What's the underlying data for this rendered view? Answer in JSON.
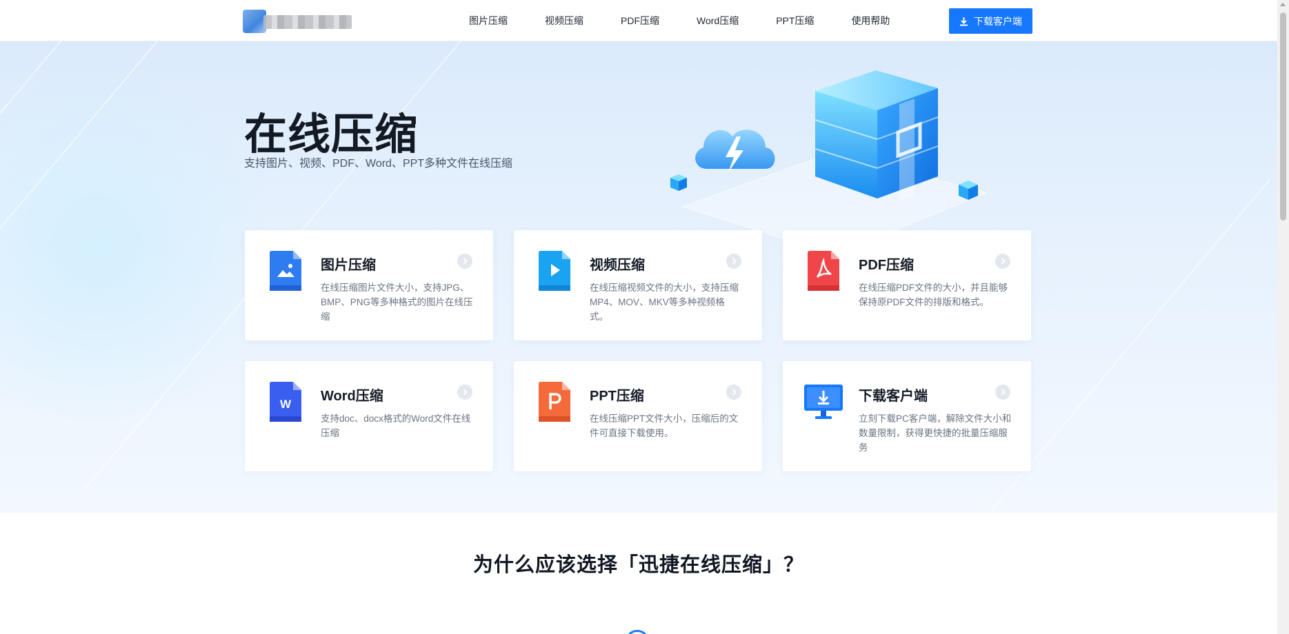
{
  "header": {
    "logo_alt": "logo",
    "nav": [
      {
        "label": "图片压缩"
      },
      {
        "label": "视频压缩"
      },
      {
        "label": "PDF压缩"
      },
      {
        "label": "Word压缩"
      },
      {
        "label": "PPT压缩"
      },
      {
        "label": "使用帮助"
      }
    ],
    "download_button": "下载客户端"
  },
  "hero": {
    "title": "在线压缩",
    "subtitle": "支持图片、视频、PDF、Word、PPT多种文件在线压缩"
  },
  "cards": [
    {
      "title": "图片压缩",
      "desc": "在线压缩图片文件大小，支持JPG、BMP、PNG等多种格式的图片在线压缩",
      "icon": "image-file-icon",
      "color": "#2f7bf0"
    },
    {
      "title": "视频压缩",
      "desc": "在线压缩视频文件的大小，支持压缩MP4、MOV、MKV等多种视频格式。",
      "icon": "video-file-icon",
      "color": "#1aa3f0"
    },
    {
      "title": "PDF压缩",
      "desc": "在线压缩PDF文件的大小，并且能够保持原PDF文件的排版和格式。",
      "icon": "pdf-file-icon",
      "color": "#f0464a"
    },
    {
      "title": "Word压缩",
      "desc": "支持doc、docx格式的Word文件在线压缩",
      "icon": "word-file-icon",
      "color": "#3a5ff0"
    },
    {
      "title": "PPT压缩",
      "desc": "在线压缩PPT文件大小，压缩后的文件可直接下载使用。",
      "icon": "ppt-file-icon",
      "color": "#f46a3a"
    },
    {
      "title": "下载客户端",
      "desc": "立刻下载PC客户端，解除文件大小和数量限制，获得更快捷的批量压缩服务",
      "icon": "desktop-download-icon",
      "color": "#1677ff"
    }
  ],
  "why": {
    "title": "为什么应该选择「迅捷在线压缩」？"
  },
  "colors": {
    "accent": "#1677ff",
    "hero_bg": "#e6f1fd",
    "text_dark": "#141a24",
    "text_muted": "#6b7482"
  }
}
